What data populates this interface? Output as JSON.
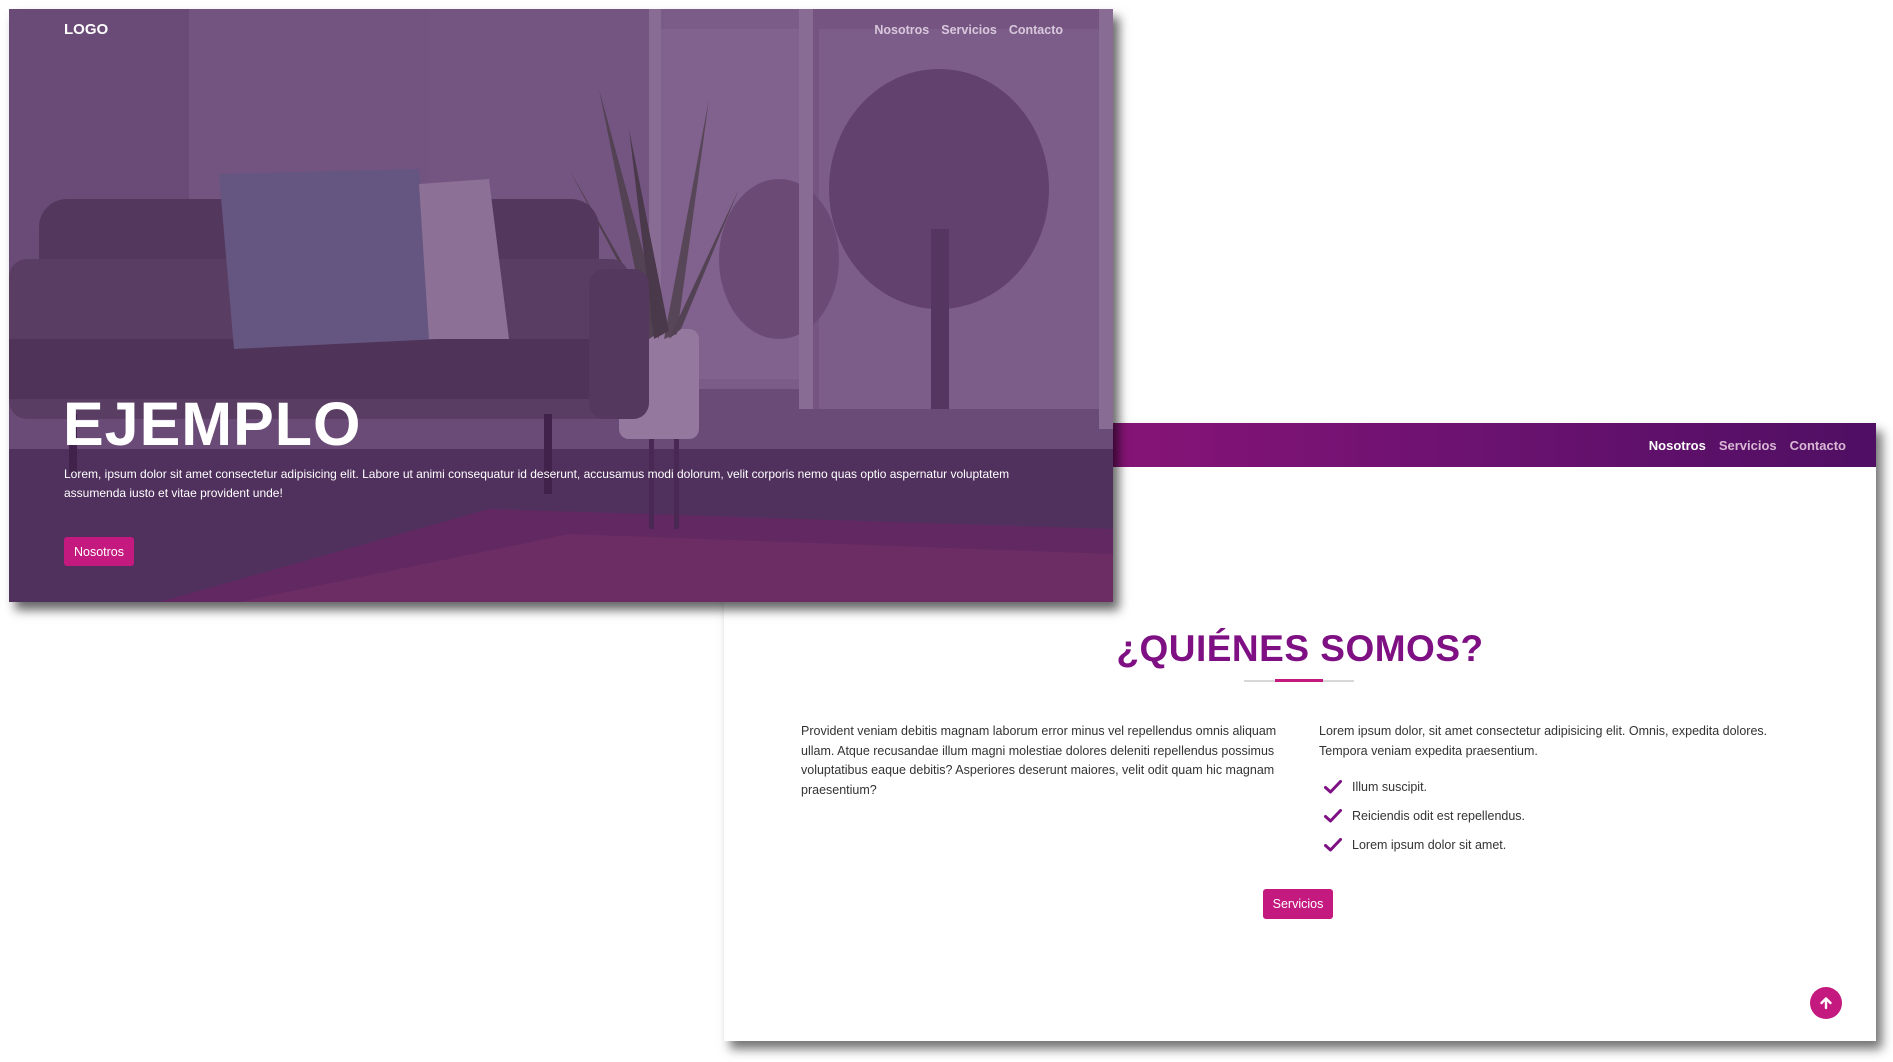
{
  "hero": {
    "logo": "LOGO",
    "nav": [
      "Nosotros",
      "Servicios",
      "Contacto"
    ],
    "title": "EJEMPLO",
    "text": "Lorem, ipsum dolor sit amet consectetur adipisicing elit. Labore ut animi consequatur id deserunt, accusamus modi dolorum, velit corporis nemo quas optio aspernatur voluptatem assumenda iusto et vitae provident unde!",
    "button_label": "Nosotros"
  },
  "about": {
    "nav": [
      "Nosotros",
      "Servicios",
      "Contacto"
    ],
    "active_nav": "Nosotros",
    "title": "¿QUIÉNES SOMOS?",
    "col1_text": "Provident veniam debitis magnam laborum error minus vel repellendus omnis aliquam ullam. Atque recusandae illum magni molestiae dolores deleniti repellendus possimus voluptatibus eaque debitis? Asperiores deserunt maiores, velit odit quam hic magnam praesentium?",
    "col2_text": "Lorem ipsum dolor, sit amet consectetur adipisicing elit. Omnis, expedita dolores. Tempora veniam expedita praesentium.",
    "checklist": [
      "Illum suscipit.",
      "Reiciendis odit est repellendus.",
      "Lorem ipsum dolor sit amet."
    ],
    "button_label": "Servicios"
  },
  "icons": {
    "check": "check-icon",
    "scroll_top": "arrow-up-icon"
  },
  "colors": {
    "accent": "#c4197f",
    "title_purple": "#7e1084",
    "nav_gradient_start": "#a0197f",
    "nav_gradient_end": "#4f0f63"
  }
}
